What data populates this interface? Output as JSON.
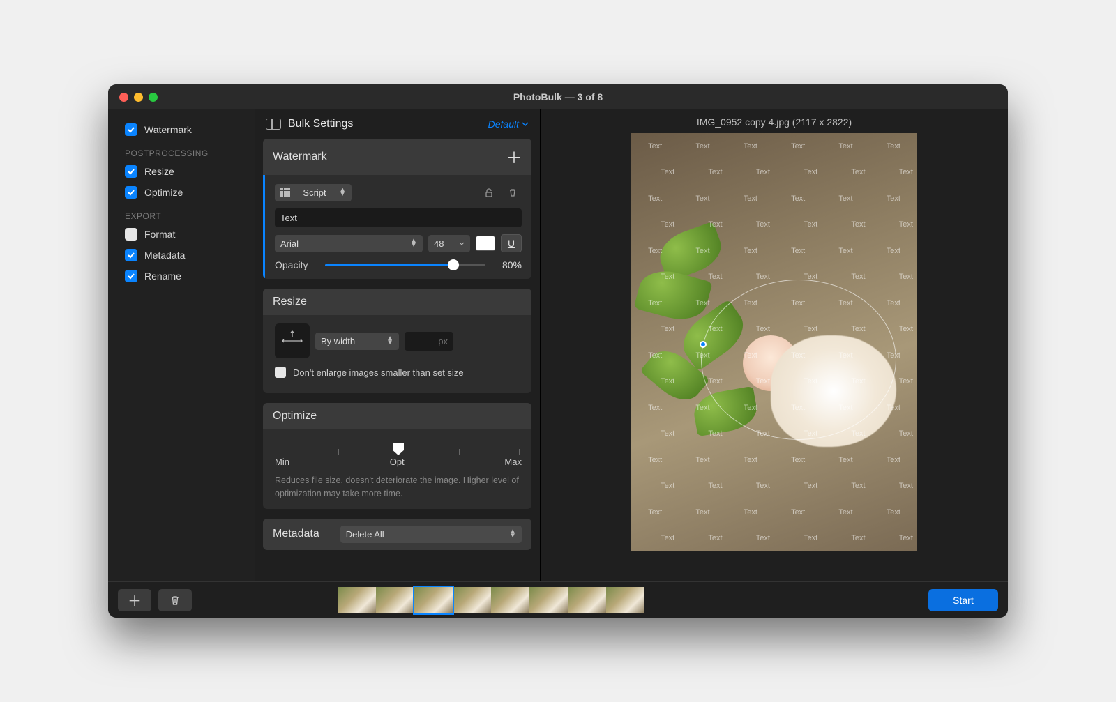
{
  "window": {
    "title": "PhotoBulk — 3 of 8"
  },
  "sidebar": {
    "watermark": "Watermark",
    "group_post": "POSTPROCESSING",
    "resize": "Resize",
    "optimize": "Optimize",
    "group_export": "EXPORT",
    "format": "Format",
    "metadata": "Metadata",
    "rename": "Rename"
  },
  "mid": {
    "title": "Bulk Settings",
    "default": "Default"
  },
  "watermark": {
    "head": "Watermark",
    "type": "Script",
    "text_value": "Text",
    "font": "Arial",
    "size": "48",
    "opacity_label": "Opacity",
    "opacity_value": "80%"
  },
  "resize": {
    "head": "Resize",
    "mode": "By width",
    "px": "px",
    "noenlarge": "Don't enlarge images smaller than set size"
  },
  "optimize": {
    "head": "Optimize",
    "min": "Min",
    "opt": "Opt",
    "max": "Max",
    "note": "Reduces file size, doesn't deteriorate the image. Higher level of optimization may take more time."
  },
  "metadata": {
    "head": "Metadata",
    "mode": "Delete All"
  },
  "preview": {
    "title": "IMG_0952 copy 4.jpg (2117 x 2822)",
    "wm_text": "Text"
  },
  "footer": {
    "start": "Start"
  },
  "colors": {
    "accent": "#0a84ff"
  }
}
